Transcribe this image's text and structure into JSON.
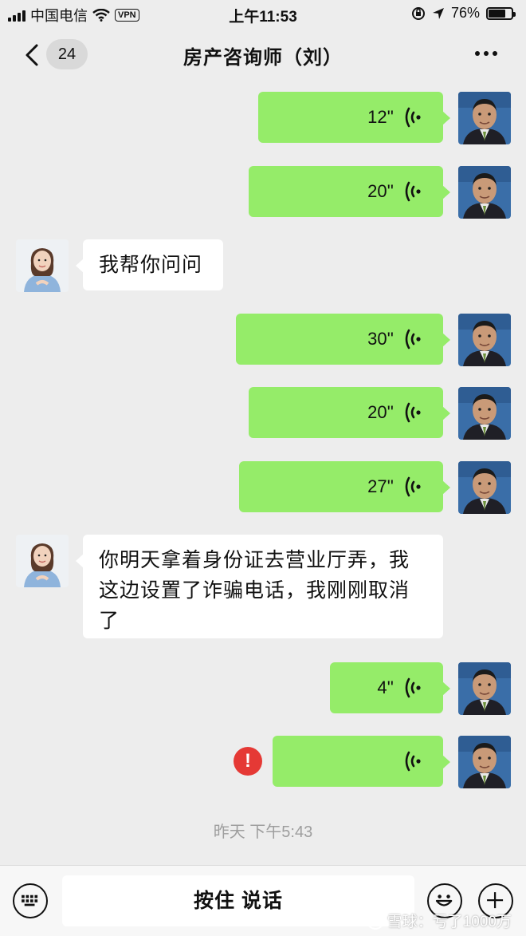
{
  "status_bar": {
    "carrier": "中国电信",
    "vpn": "VPN",
    "time": "上午11:53",
    "battery": "76%",
    "battery_level": 0.76
  },
  "header": {
    "back_badge": "24",
    "title": "房产咨询师（刘）"
  },
  "messages": [
    {
      "side": "right",
      "type": "voice",
      "duration": "12''"
    },
    {
      "side": "right",
      "type": "voice",
      "duration": "20''"
    },
    {
      "side": "left",
      "type": "text",
      "text": "我帮你问问"
    },
    {
      "side": "right",
      "type": "voice",
      "duration": "30''"
    },
    {
      "side": "right",
      "type": "voice",
      "duration": "20''"
    },
    {
      "side": "right",
      "type": "voice",
      "duration": "27''"
    },
    {
      "side": "left",
      "type": "text",
      "text": "你明天拿着身份证去营业厅弄，我这边设置了诈骗电话，我刚刚取消了"
    },
    {
      "side": "right",
      "type": "voice",
      "duration": "4''"
    },
    {
      "side": "right",
      "type": "voice",
      "duration": "",
      "failed": true,
      "error_mark": "!"
    }
  ],
  "timestamp": "昨天 下午5:43",
  "input_bar": {
    "hold_to_talk": "按住 说话"
  },
  "watermark": "雪球：亏了1000万",
  "colors": {
    "background": "#ededed",
    "sent_bubble": "#95ec69",
    "received_bubble": "#ffffff",
    "error": "#e53935"
  }
}
